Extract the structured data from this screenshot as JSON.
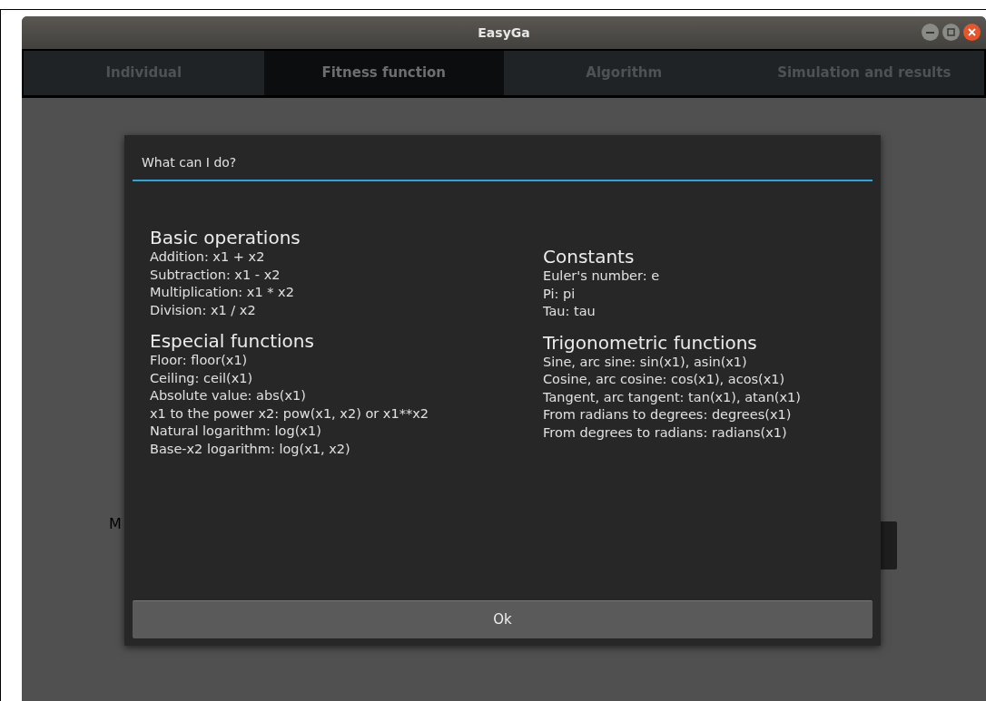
{
  "window": {
    "title": "EasyGa"
  },
  "tabs": [
    {
      "label": "Individual",
      "selected": false
    },
    {
      "label": "Fitness function",
      "selected": true
    },
    {
      "label": "Algorithm",
      "selected": false
    },
    {
      "label": "Simulation and results",
      "selected": false
    }
  ],
  "background": {
    "label": "M"
  },
  "dialog": {
    "title": "What can I do?",
    "columns": [
      {
        "sections": [
          {
            "heading": "Basic operations",
            "items": [
              "Addition: x1 + x2",
              "Subtraction: x1 - x2",
              "Multiplication: x1 * x2",
              "Division: x1 / x2"
            ]
          },
          {
            "heading": "Especial functions",
            "items": [
              "Floor: floor(x1)",
              "Ceiling: ceil(x1)",
              "Absolute value: abs(x1)",
              "x1 to the power x2: pow(x1, x2) or x1**x2",
              "Natural logarithm: log(x1)",
              "Base-x2 logarithm: log(x1, x2)"
            ]
          }
        ]
      },
      {
        "sections": [
          {
            "heading": "Constants",
            "items": [
              "Euler's number: e",
              "Pi: pi",
              "Tau: tau"
            ]
          },
          {
            "heading": "Trigonometric functions",
            "items": [
              "Sine, arc sine: sin(x1), asin(x1)",
              "Cosine, arc cosine: cos(x1), acos(x1)",
              "Tangent, arc tangent: tan(x1), atan(x1)",
              "From radians to degrees: degrees(x1)",
              "From degrees to radians: radians(x1)"
            ]
          }
        ]
      }
    ],
    "button": "Ok"
  }
}
